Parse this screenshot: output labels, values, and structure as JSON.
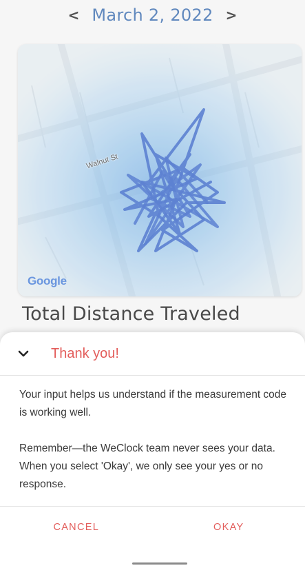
{
  "date_nav": {
    "prev_symbol": "<",
    "date": "March 2, 2022",
    "next_symbol": ">"
  },
  "map": {
    "street_label": "Walnut St",
    "attribution": "Google",
    "path_color": "#3a66c8",
    "heat_color": "#7ab6e8"
  },
  "section": {
    "title": "Total Distance Traveled"
  },
  "sheet": {
    "title": "Thank you!",
    "paragraphs": [
      "Your input helps us understand if the measurement code is working well.",
      "Remember—the WeClock team never sees your data. When you select 'Okay', we only see your yes or no response."
    ],
    "cancel_label": "CANCEL",
    "okay_label": "OKAY",
    "accent_color": "#e35d5b"
  }
}
